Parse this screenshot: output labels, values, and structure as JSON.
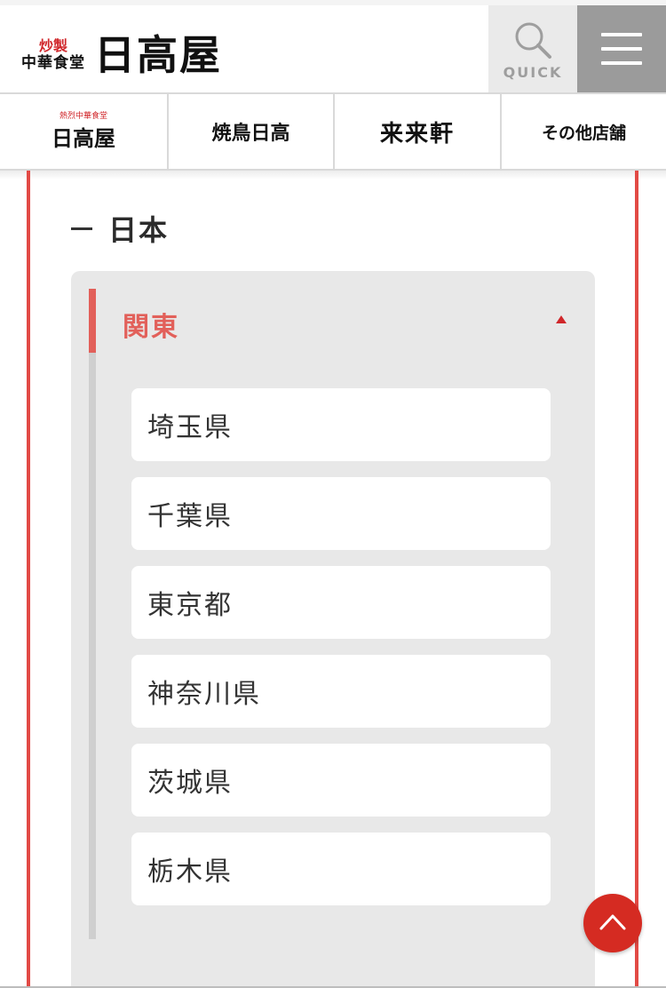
{
  "header": {
    "logo": {
      "tag_top": "炒製",
      "tag_bottom": "中華食堂",
      "main": "日高屋"
    },
    "quick_label": "QUICK",
    "icons": {
      "search": "search-icon",
      "menu": "hamburger-menu-icon"
    }
  },
  "brands": [
    {
      "tag": "熱烈中華食堂",
      "label": "日高屋"
    },
    {
      "label": "焼鳥日高"
    },
    {
      "label": "来来軒"
    },
    {
      "label": "その他店舗"
    }
  ],
  "country": {
    "name": "日本"
  },
  "region": {
    "name": "関東",
    "expanded": true
  },
  "prefectures": [
    "埼玉県",
    "千葉県",
    "東京都",
    "神奈川県",
    "茨城県",
    "栃木県"
  ],
  "colors": {
    "accent": "#e2605a",
    "brand_red": "#d52b22",
    "panel_bg": "#e8e8e8"
  },
  "back_to_top_icon": "chevron-up-icon"
}
